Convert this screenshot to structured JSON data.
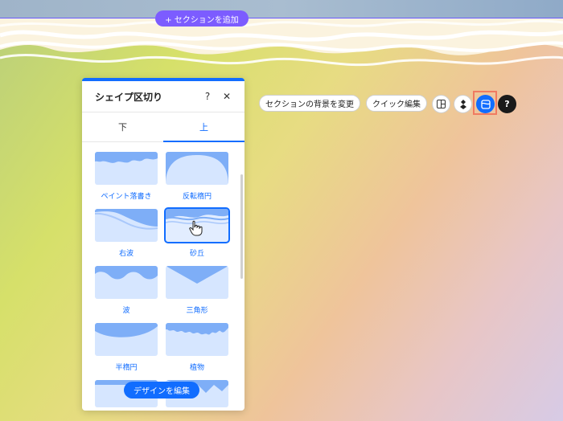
{
  "editor": {
    "add_section_label": "+ セクションを追加"
  },
  "panel": {
    "title": "シェイプ区切り",
    "help_icon": "?",
    "close_icon": "✕",
    "tabs": [
      {
        "label": "下",
        "active": false
      },
      {
        "label": "上",
        "active": true
      }
    ],
    "shapes": [
      {
        "label": "ペイント落書き",
        "icon": "paint-scribble-shape",
        "selected": false
      },
      {
        "label": "反転楕円",
        "icon": "inverted-ellipse-shape",
        "selected": false
      },
      {
        "label": "右波",
        "icon": "right-wave-shape",
        "selected": false
      },
      {
        "label": "砂丘",
        "icon": "dunes-shape",
        "selected": true
      },
      {
        "label": "波",
        "icon": "wave-shape",
        "selected": false
      },
      {
        "label": "三角形",
        "icon": "triangle-shape",
        "selected": false
      },
      {
        "label": "半楕円",
        "icon": "half-ellipse-shape",
        "selected": false
      },
      {
        "label": "植物",
        "icon": "plant-shape",
        "selected": false
      }
    ],
    "edit_design_label": "デザインを編集"
  },
  "toolbar": {
    "change_background_label": "セクションの背景を変更",
    "quick_edit_label": "クイック編集",
    "icons": [
      "layout-icon",
      "animation-icon",
      "shape-divider-icon",
      "help-icon"
    ],
    "help_symbol": "?"
  },
  "colors": {
    "accent": "#116dff",
    "add_section": "#7c5cff",
    "highlight": "#f07b61",
    "shape_fill": "#7eaef7",
    "tile_bg": "#d6e6ff"
  }
}
